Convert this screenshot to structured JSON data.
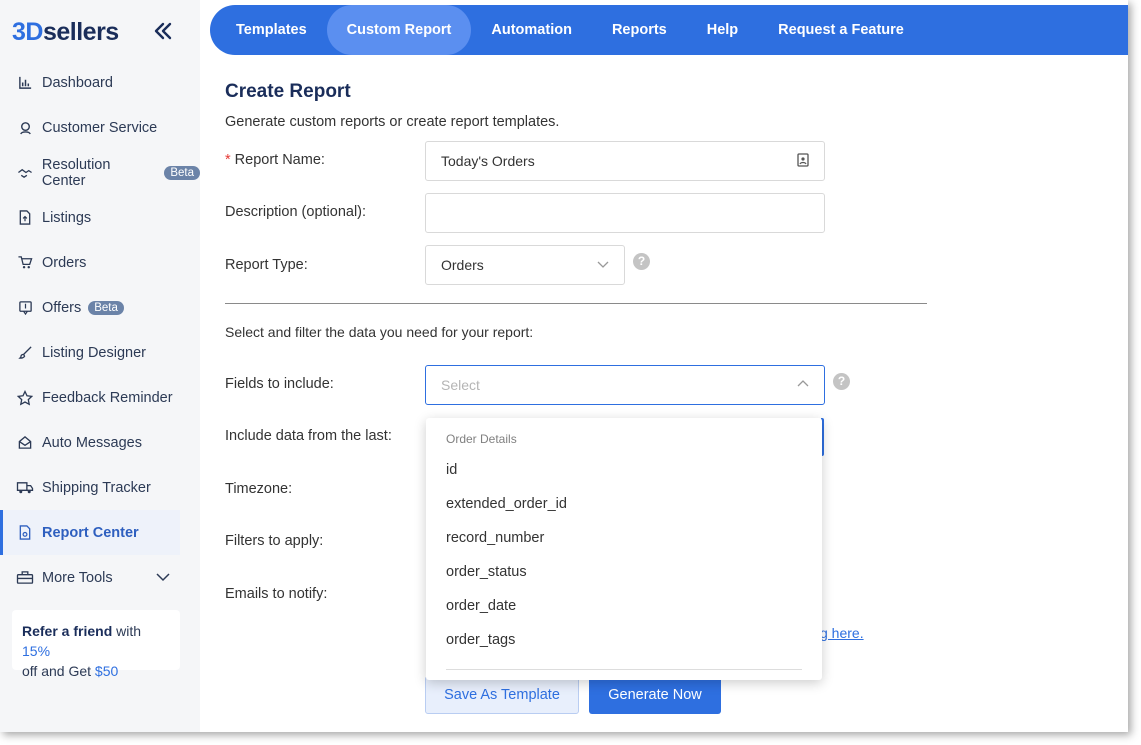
{
  "brand": {
    "logo_a": "3D",
    "logo_b": "sellers"
  },
  "sidebar": {
    "items": [
      {
        "label": "Dashboard",
        "icon": "bar-chart-icon"
      },
      {
        "label": "Customer Service",
        "icon": "headset-icon"
      },
      {
        "label": "Resolution Center",
        "icon": "handshake-icon",
        "badge": "Beta"
      },
      {
        "label": "Listings",
        "icon": "document-upload-icon"
      },
      {
        "label": "Orders",
        "icon": "cart-icon"
      },
      {
        "label": "Offers",
        "icon": "offer-icon",
        "badge": "Beta"
      },
      {
        "label": "Listing Designer",
        "icon": "brush-icon"
      },
      {
        "label": "Feedback Reminder",
        "icon": "star-icon"
      },
      {
        "label": "Auto Messages",
        "icon": "envelope-icon"
      },
      {
        "label": "Shipping Tracker",
        "icon": "truck-icon"
      },
      {
        "label": "Report Center",
        "icon": "report-icon",
        "active": true
      },
      {
        "label": "More Tools",
        "icon": "toolbox-icon"
      }
    ],
    "refer": {
      "strong": "Refer a friend",
      "t1": " with ",
      "pct": "15%",
      "t2": " off and Get ",
      "amt": "$50"
    }
  },
  "topnav": {
    "tabs": [
      "Templates",
      "Custom Report",
      "Automation",
      "Reports",
      "Help",
      "Request a Feature"
    ],
    "active": "Custom Report"
  },
  "form": {
    "title": "Create Report",
    "subtitle": "Generate custom reports or create report templates.",
    "report_name_label": "Report Name:",
    "report_name_value": "Today's Orders",
    "description_label": "Description (optional):",
    "description_value": "",
    "report_type_label": "Report Type:",
    "report_type_value": "Orders",
    "section_hint": "Select and filter the data you need for your report:",
    "fields_label": "Fields to include:",
    "fields_placeholder": "Select",
    "include_label": "Include data from the last:",
    "timezone_label": "Timezone:",
    "filters_label": "Filters to apply:",
    "emails_label": "Emails to notify:",
    "link_fragment": "g here.",
    "save_template": "Save As Template",
    "generate_now": "Generate Now"
  },
  "dropdown": {
    "group": "Order Details",
    "options": [
      "id",
      "extended_order_id",
      "record_number",
      "order_status",
      "order_date",
      "order_tags"
    ]
  },
  "colors": {
    "primary": "#2e6fe0",
    "navy": "#1a2d5a",
    "required": "#e53935"
  }
}
